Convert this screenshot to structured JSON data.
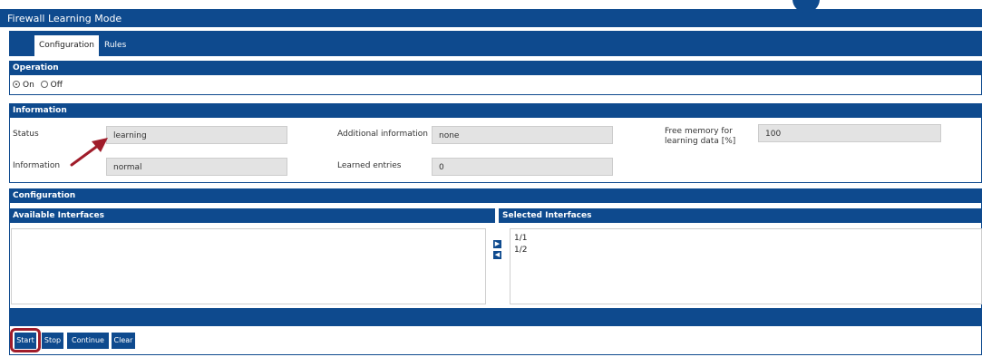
{
  "window": {
    "title": "Firewall Learning Mode"
  },
  "tabs": [
    {
      "label": "Configuration",
      "active": true
    },
    {
      "label": "Rules",
      "active": false
    }
  ],
  "operation": {
    "heading": "Operation",
    "options": [
      {
        "label": "On",
        "selected": true
      },
      {
        "label": "Off",
        "selected": false
      }
    ]
  },
  "information": {
    "heading": "Information",
    "status_label": "Status",
    "status_value": "learning",
    "additional_label": "Additional information",
    "additional_value": "none",
    "free_memory_label_line1": "Free memory for",
    "free_memory_label_line2": "learning data [%]",
    "free_memory_value": "100",
    "info_label": "Information",
    "info_value": "normal",
    "learned_label": "Learned entries",
    "learned_value": "0"
  },
  "configuration": {
    "heading": "Configuration",
    "available_heading": "Available Interfaces",
    "available_items": [],
    "selected_heading": "Selected Interfaces",
    "selected_items": [
      "1/1",
      "1/2"
    ],
    "move_right_icon": "arrow-right-icon",
    "move_left_icon": "arrow-left-icon"
  },
  "actions": {
    "start": "Start",
    "stop": "Stop",
    "continue": "Continue",
    "clear": "Clear"
  },
  "colors": {
    "header_blue": "#0e4a8e",
    "field_gray": "#e3e3e3",
    "annotation_red": "#a01c2a"
  }
}
